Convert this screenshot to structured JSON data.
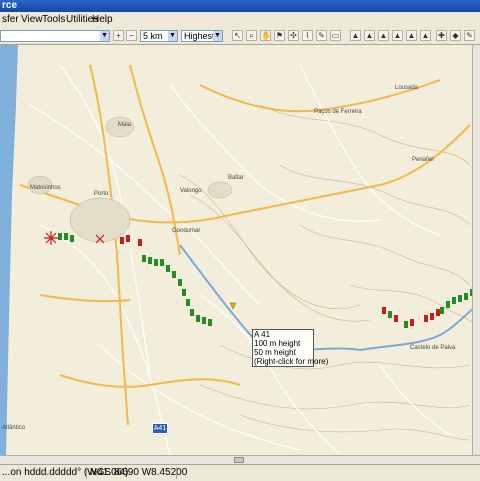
{
  "window": {
    "title_fragment": "rce"
  },
  "menu": {
    "items": [
      "sfer",
      "View",
      "Tools",
      "Utilities",
      "Help"
    ]
  },
  "toolbar": {
    "scale_value": "5 km",
    "detail_value": "Highest",
    "zoom_in_icon": "magnifier-plus-icon",
    "zoom_out_icon": "magnifier-minus-icon"
  },
  "map": {
    "tooltip": {
      "road": "A 41",
      "line1": "100 m height",
      "line2": "50 m height",
      "hint": "(Right-click for more)"
    },
    "road_sign": "A41",
    "place_labels": [
      "Maia",
      "Porto",
      "Matosinhos",
      "Valongo",
      "Baltar",
      "Paços de Ferreira",
      "Lousada",
      "Penafiel",
      "Gondomar",
      "Castelo de Paiva",
      "Atlântico"
    ],
    "colors": {
      "land": "#f3eedb",
      "sea": "#7fb0dc",
      "highway": "#f2b84b",
      "road": "#ffffff",
      "river": "#7aa7d8",
      "contour": "#c9b48a",
      "marker_green": "#1e8f22",
      "marker_red": "#cc1a1a"
    }
  },
  "status": {
    "format": "...on hddd.ddddd° (WGS 84)",
    "coords": "N41.06690 W8.45200"
  }
}
